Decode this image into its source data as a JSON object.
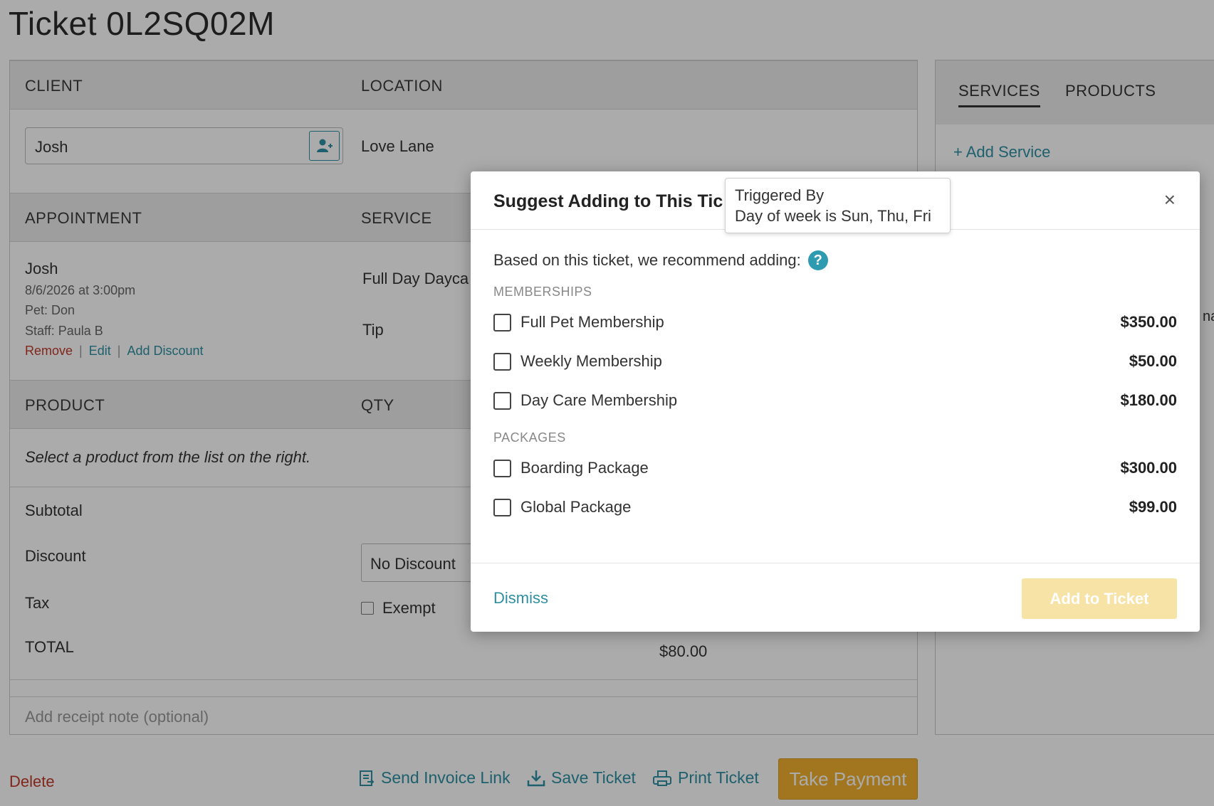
{
  "page": {
    "title": "Ticket 0L2SQ02M"
  },
  "client_section": {
    "client_header": "CLIENT",
    "location_header": "LOCATION",
    "client_value": "Josh",
    "location_value": "Love Lane"
  },
  "appointment_section": {
    "appointment_header": "APPOINTMENT",
    "service_header": "SERVICE",
    "name": "Josh",
    "datetime": "8/6/2026 at 3:00pm",
    "pet": "Pet: Don",
    "staff": "Staff: Paula B",
    "links": {
      "remove": "Remove",
      "edit": "Edit",
      "add_discount": "Add Discount",
      "separator": "|"
    },
    "service_value": "Full Day Dayca",
    "tip_label": "Tip"
  },
  "product_section": {
    "product_header": "PRODUCT",
    "qty_header": "QTY",
    "hint": "Select a product from the list on the right."
  },
  "summary": {
    "subtotal_label": "Subtotal",
    "discount_label": "Discount",
    "discount_value": "No Discount",
    "tax_label": "Tax",
    "exempt_label": "Exempt",
    "total_label": "TOTAL",
    "total_value": "$80.00"
  },
  "receipt_note": {
    "placeholder": "Add receipt note (optional)"
  },
  "right_panel": {
    "tabs": [
      "SERVICES",
      "PRODUCTS"
    ],
    "add_service": "+ Add Service",
    "fragment": "na"
  },
  "bottom_bar": {
    "delete": "Delete",
    "send_invoice": "Send Invoice Link",
    "save_ticket": "Save Ticket",
    "print_ticket": "Print Ticket",
    "take_payment": "Take Payment"
  },
  "modal": {
    "title": "Suggest Adding to This Tic",
    "close": "×",
    "tooltip_title": "Triggered By",
    "tooltip_body": "Day of week is Sun, Thu, Fri",
    "intro": "Based on this ticket, we recommend adding:",
    "help_glyph": "?",
    "memberships_header": "MEMBERSHIPS",
    "memberships": [
      {
        "name": "Full Pet Membership",
        "price": "$350.00"
      },
      {
        "name": "Weekly Membership",
        "price": "$50.00"
      },
      {
        "name": "Day Care Membership",
        "price": "$180.00"
      }
    ],
    "packages_header": "PACKAGES",
    "packages": [
      {
        "name": "Boarding Package",
        "price": "$300.00"
      },
      {
        "name": "Global Package",
        "price": "$99.00"
      }
    ],
    "dismiss": "Dismiss",
    "add_to_ticket": "Add to Ticket"
  },
  "colors": {
    "link": "#2e8fa3",
    "danger": "#c0392b",
    "primary_button": "#f0b02f",
    "primary_button_disabled": "#f7e3a5"
  }
}
